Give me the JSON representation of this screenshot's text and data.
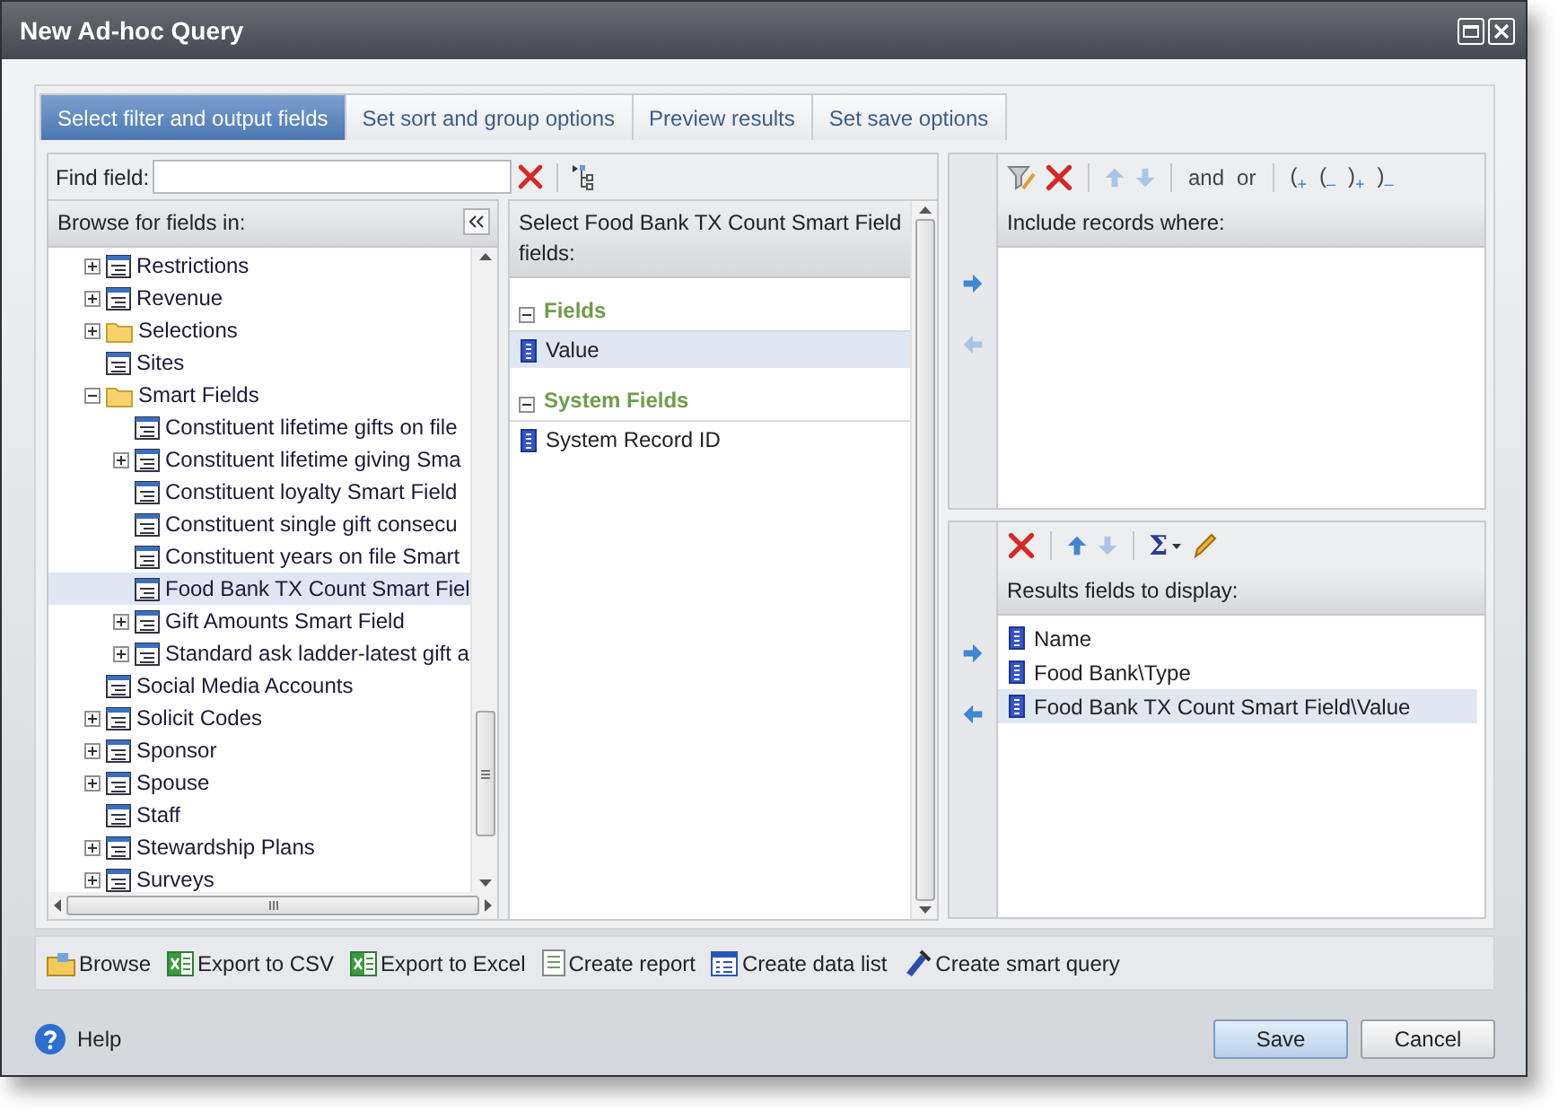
{
  "window": {
    "title": "New Ad-hoc Query"
  },
  "tabs": [
    {
      "label": "Select filter and output fields",
      "selected": true
    },
    {
      "label": "Set sort and group options",
      "selected": false
    },
    {
      "label": "Preview results",
      "selected": false
    },
    {
      "label": "Set save options",
      "selected": false
    }
  ],
  "find_field": {
    "label": "Find field:"
  },
  "browser": {
    "title": "Browse for fields in:",
    "items": [
      {
        "label": "Restrictions",
        "kind": "table",
        "expanded": false,
        "selected": false
      },
      {
        "label": "Revenue",
        "kind": "table",
        "expanded": false,
        "selected": false
      },
      {
        "label": "Selections",
        "kind": "folder",
        "expanded": false,
        "selected": false
      },
      {
        "label": "Sites",
        "kind": "table",
        "selected": false
      },
      {
        "label": "Smart Fields",
        "kind": "folder",
        "expanded": true,
        "selected": false,
        "children": [
          {
            "label": "Constituent lifetime gifts on file",
            "kind": "table",
            "selected": false
          },
          {
            "label": "Constituent lifetime giving Sma",
            "kind": "table",
            "expanded": false,
            "selected": false
          },
          {
            "label": "Constituent loyalty Smart Field",
            "kind": "table",
            "selected": false
          },
          {
            "label": "Constituent single gift consecu",
            "kind": "table",
            "selected": false
          },
          {
            "label": "Constituent years on file Smart",
            "kind": "table",
            "selected": false
          },
          {
            "label": "Food Bank TX Count Smart Fiel",
            "kind": "table",
            "selected": true
          },
          {
            "label": "Gift Amounts Smart Field",
            "kind": "table",
            "expanded": false,
            "selected": false
          },
          {
            "label": "Standard ask ladder-latest gift a",
            "kind": "table",
            "expanded": false,
            "selected": false
          }
        ]
      },
      {
        "label": "Social Media Accounts",
        "kind": "table",
        "selected": false
      },
      {
        "label": "Solicit Codes",
        "kind": "table",
        "expanded": false,
        "selected": false
      },
      {
        "label": "Sponsor",
        "kind": "table",
        "expanded": false,
        "selected": false
      },
      {
        "label": "Spouse",
        "kind": "table",
        "expanded": false,
        "selected": false
      },
      {
        "label": "Staff",
        "kind": "table",
        "selected": false
      },
      {
        "label": "Stewardship Plans",
        "kind": "table",
        "expanded": false,
        "selected": false
      },
      {
        "label": "Surveys",
        "kind": "table",
        "expanded": false,
        "selected": false
      }
    ]
  },
  "field_list": {
    "title": "Select Food Bank TX Count Smart Field fields:",
    "groups": [
      {
        "label": "Fields",
        "expanded": true,
        "fields": [
          {
            "label": "Value",
            "selected": true
          }
        ]
      },
      {
        "label": "System Fields",
        "expanded": true,
        "fields": [
          {
            "label": "System Record ID",
            "selected": false
          }
        ]
      }
    ]
  },
  "filter": {
    "title": "Include records where:",
    "toolbar": [
      {
        "kind": "filter"
      },
      {
        "kind": "delete"
      },
      {
        "kind": "separator"
      },
      {
        "kind": "up",
        "disabled": true
      },
      {
        "kind": "down",
        "disabled": true
      },
      {
        "kind": "separator"
      },
      {
        "kind": "text",
        "label": "and"
      },
      {
        "kind": "text",
        "label": "or"
      },
      {
        "kind": "separator"
      },
      {
        "kind": "text",
        "label": "($_{+}$"
      },
      {
        "kind": "text",
        "label": "($_{–}$"
      },
      {
        "kind": "text",
        "label": ")$_{+}$"
      },
      {
        "kind": "text",
        "label": ")$_{–}$"
      }
    ],
    "move_buttons": [
      {
        "disabled": false
      },
      {
        "disabled": true
      }
    ]
  },
  "results": {
    "title": "Results fields to display:",
    "toolbar": [
      {
        "kind": "delete"
      },
      {
        "kind": "separator"
      },
      {
        "kind": "up",
        "disabled": false
      },
      {
        "kind": "down",
        "disabled": true
      },
      {
        "kind": "separator"
      },
      {
        "kind": "sum",
        "label": "Σ"
      },
      {
        "kind": "rename"
      }
    ],
    "fields": [
      {
        "label": "Name",
        "selected": false
      },
      {
        "label": "Food Bank\\Type",
        "selected": false
      },
      {
        "label": "Food Bank TX Count Smart Field\\Value",
        "selected": true
      }
    ],
    "move_buttons": [
      {
        "disabled": false
      },
      {
        "disabled": false
      }
    ]
  },
  "actions": [
    {
      "label": "Browse",
      "kind": "folder"
    },
    {
      "label": "Export to CSV",
      "kind": "sheet"
    },
    {
      "label": "Export to Excel",
      "kind": "sheet"
    },
    {
      "label": "Create report",
      "kind": "report"
    },
    {
      "label": "Create data list",
      "kind": "list"
    },
    {
      "label": "Create smart query",
      "kind": "wand"
    }
  ],
  "footer": {
    "help": "Help",
    "buttons": [
      {
        "label": "Save",
        "default": true
      },
      {
        "label": "Cancel",
        "default": false
      }
    ]
  }
}
